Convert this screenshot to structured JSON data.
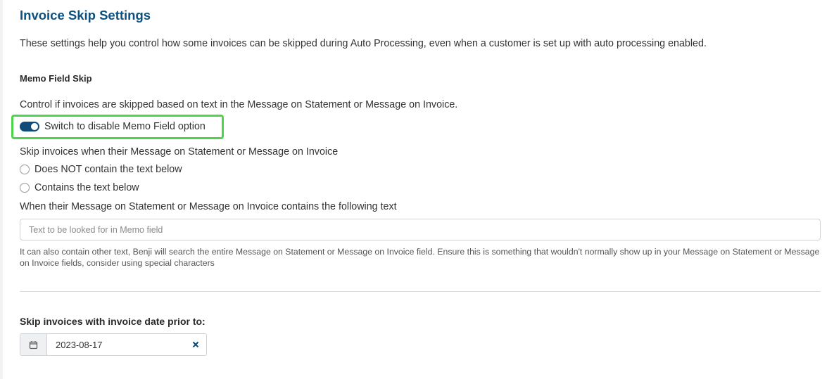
{
  "page": {
    "title": "Invoice Skip Settings",
    "intro": "These settings help you control how some invoices can be skipped during Auto Processing, even when a customer is set up with auto processing enabled."
  },
  "memo_section": {
    "heading": "Memo Field Skip",
    "description": "Control if invoices are skipped based on text in the Message on Statement or Message on Invoice.",
    "toggle": {
      "label": "Switch to disable Memo Field option",
      "state": "on"
    },
    "skip_prompt": "Skip invoices when their Message on Statement or Message on Invoice",
    "options": [
      {
        "label": "Does NOT contain the text below",
        "selected": false
      },
      {
        "label": "Contains the text below",
        "selected": false
      }
    ],
    "text_prompt": "When their Message on Statement or Message on Invoice contains the following text",
    "input": {
      "placeholder": "Text to be looked for in Memo field",
      "value": ""
    },
    "help": "It can also contain other text, Benji will search the entire Message on Statement or Message on Invoice field. Ensure this is something that wouldn't normally show up in your Message on Statement or Message on Invoice fields, consider using special characters"
  },
  "date_section": {
    "label": "Skip invoices with invoice date prior to:",
    "value": "2023-08-17",
    "prefix_icon": "calendar-icon",
    "clear_icon": "close-icon"
  },
  "colors": {
    "title": "#0d4f7e",
    "toggle_on": "#0f4c7a",
    "highlight": "#4cd44a",
    "clear_icon": "#0f4c7a"
  }
}
